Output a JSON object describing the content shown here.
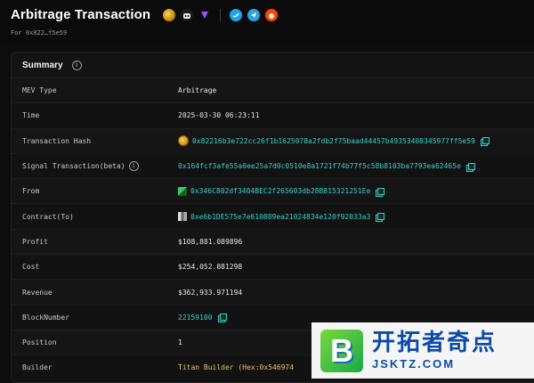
{
  "header": {
    "title": "Arbitrage Transaction",
    "subline": "For 0x822…f5e59",
    "icons": [
      "coin-icon",
      "bot-icon",
      "flashbots-icon",
      "twitter-icon",
      "telegram-icon",
      "reddit-icon"
    ]
  },
  "summary": {
    "title": "Summary",
    "rows": [
      {
        "label": "MEV Type",
        "value": "Arbitrage"
      },
      {
        "label": "Time",
        "value": "2025-03-30 06:23:11"
      },
      {
        "label": "Transaction Hash",
        "value": "0x82216b3e722cc26f1b1625078a2fdb2f75baad44457b49353408345977ff5e59"
      },
      {
        "label": "Signal Transaction(beta)",
        "value": "0x164fcf3afe55a0ee25a7d0c0510e8a1721f74b77f5c58b8103ba7793ea62465e"
      },
      {
        "label": "From",
        "value": "0x346C802df3404BEC2f265603db28B815321251Ee"
      },
      {
        "label": "Contract(To)",
        "value": "0xe6b1DE575e7e610889ea21024834e120f92033a3"
      },
      {
        "label": "Profit",
        "value": "$108,881.089896"
      },
      {
        "label": "Cost",
        "value": "$254,052.881298"
      },
      {
        "label": "Revenue",
        "value": "$362,933.971194"
      },
      {
        "label": "BlockNumber",
        "value": "22159100"
      },
      {
        "label": "Position",
        "value": "1"
      },
      {
        "label": "Builder",
        "value": "Titan Builder (Hex:0x546974"
      }
    ]
  },
  "watermark": {
    "cn": "开拓者奇点",
    "domain": "JSKTZ.COM"
  },
  "colors": {
    "accent": "#39d0c8",
    "background": "#0d0d0d",
    "watermark_blue": "#0c4aa6"
  }
}
